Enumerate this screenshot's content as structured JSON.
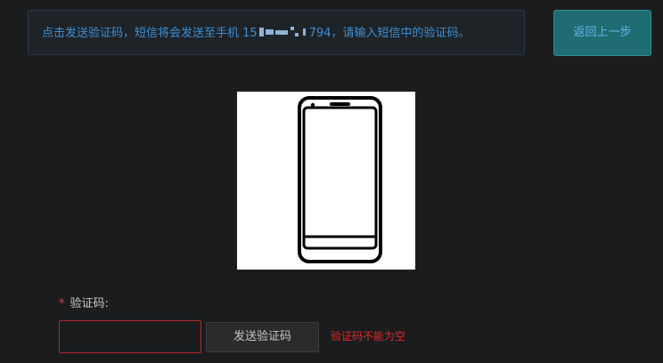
{
  "notice": {
    "text_before": "点击发送验证码，短信将会发送至手机 1",
    "phone_visible_prefix": "5",
    "phone_visible_suffix": "794",
    "text_after": "，请输入短信中的验证码。"
  },
  "back_button": {
    "label": "返回上一步"
  },
  "illustration": {
    "icon": "smartphone-icon"
  },
  "form": {
    "required_marker": "*",
    "code_label": "验证码:",
    "code_input": {
      "value": "",
      "placeholder": ""
    },
    "send_button_label": "发送验证码",
    "error_text": "验证码不能为空"
  },
  "colors": {
    "background": "#1b1c1e",
    "notice_text": "#3f8fd0",
    "accent_button": "#1f6c72",
    "error": "#e02a2a"
  }
}
